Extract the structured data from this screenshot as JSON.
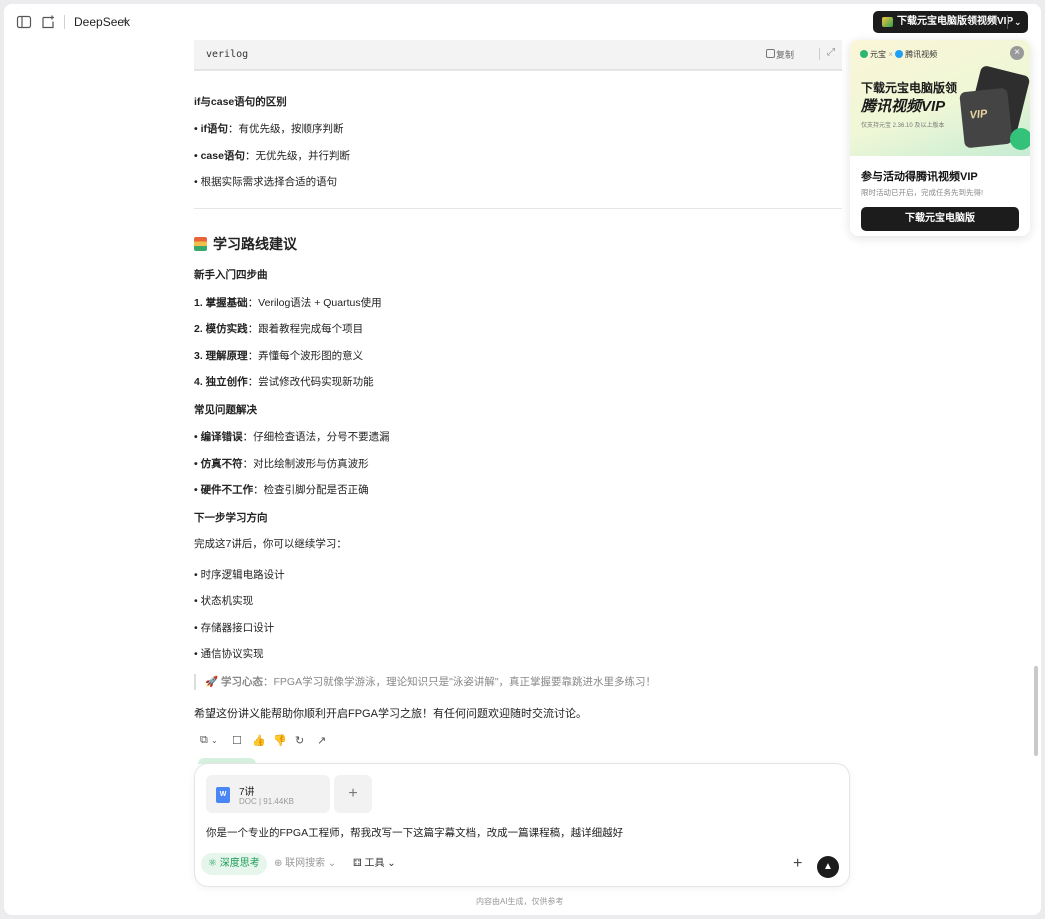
{
  "topbar": {
    "brand": "DeepSeek",
    "brand_caret": "⌄",
    "vip_button": "下载元宝电脑版领视频VIP",
    "vip_caret": "⌄"
  },
  "codeblock": {
    "lang": "verilog",
    "copy_label": "复制",
    "expand_glyph": "⤢"
  },
  "content": {
    "section1_title": "if与case语句的区别",
    "if_label": "• if语句",
    "if_text": "：有优先级，按顺序判断",
    "case_label": "• case语句",
    "case_text": "：无优先级，并行判断",
    "choose": "• 根据实际需求选择合适的语句",
    "route_title": "学习路线建议",
    "beginner_title": "新手入门四步曲",
    "steps": [
      {
        "label": "1. 掌握基础",
        "text": "：Verilog语法 + Quartus使用"
      },
      {
        "label": "2. 模仿实践",
        "text": "：跟着教程完成每个项目"
      },
      {
        "label": "3. 理解原理",
        "text": "：弄懂每个波形图的意义"
      },
      {
        "label": "4. 独立创作",
        "text": "：尝试修改代码实现新功能"
      }
    ],
    "problems_title": "常见问题解决",
    "problems": [
      {
        "label": "• 编译错误",
        "text": "：仔细检查语法，分号不要遗漏"
      },
      {
        "label": "• 仿真不符",
        "text": "：对比绘制波形与仿真波形"
      },
      {
        "label": "• 硬件不工作",
        "text": "：检查引脚分配是否正确"
      }
    ],
    "next_title": "下一步学习方向",
    "next_intro": "完成这7讲后，你可以继续学习：",
    "next_items": [
      "• 时序逻辑电路设计",
      "• 状态机实现",
      "• 存储器接口设计",
      "• 通信协议实现"
    ],
    "quote_label": "学习心态",
    "quote_text": "：FPGA学习就像学游泳，理论知识只是\"泳姿讲解\"，真正掌握要靠跳进水里多练习！",
    "closing": "希望这份讲义能帮助你顺利开启FPGA学习之旅！有任何问题欢迎随时交流讨论。"
  },
  "actions": [
    "⧉",
    "⌄",
    "☐",
    "👍",
    "👎",
    "↻",
    "↗"
  ],
  "promo": {
    "logo_yuanbao": "元宝",
    "logo_x": "×",
    "logo_tencent": "腾讯视频",
    "close_glyph": "×",
    "banner_line1": "下载元宝电脑版领",
    "banner_line2": "腾讯视频VIP",
    "banner_note": "仅支持元宝 2.36.10 及以上版本",
    "card_text": "VIP",
    "title": "参与活动得腾讯视频VIP",
    "subtitle": "限时活动已开启，完成任务先到先得!",
    "button": "下载元宝电脑版"
  },
  "composer": {
    "file_icon": "W",
    "file_name": "7讲",
    "file_meta": "DOC | 91.44KB",
    "add_file": "+",
    "prompt": "你是一个专业的FPGA工程师，帮我改写一下这篇字幕文档，改成一篇课程稿，越详细越好",
    "deep_think": "⚛ 深度思考",
    "web_search": "⊕ 联网搜索 ⌄",
    "tools": "⚃ 工具 ⌄",
    "plus": "+",
    "send": "▲"
  },
  "footer": "内容由AI生成，仅供参考"
}
